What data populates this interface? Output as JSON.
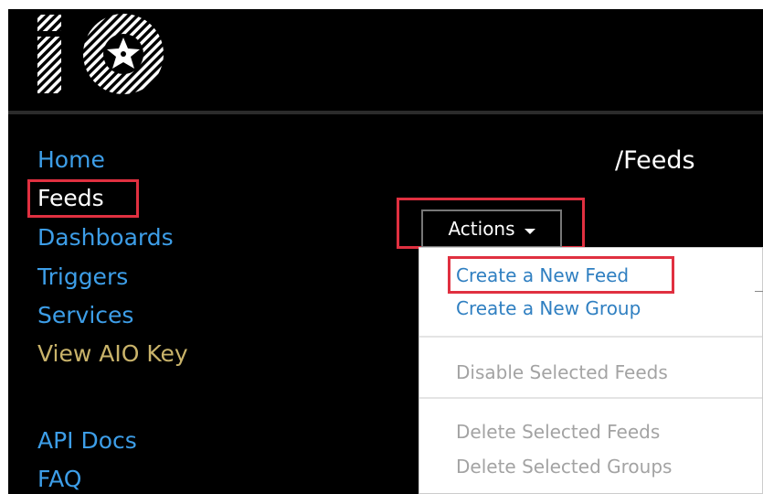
{
  "header": {
    "logo_icon": "adafruit-io-logo-icon"
  },
  "sidebar": {
    "items": [
      {
        "label": "Home",
        "color": "#3d9ee8"
      },
      {
        "label": "Feeds",
        "color": "#ffffff"
      },
      {
        "label": "Dashboards",
        "color": "#3d9ee8"
      },
      {
        "label": "Triggers",
        "color": "#3d9ee8"
      },
      {
        "label": "Services",
        "color": "#3d9ee8"
      },
      {
        "label": "View AIO Key",
        "color": "#c9b36a"
      },
      {
        "label": "API Docs",
        "color": "#3d9ee8"
      },
      {
        "label": "FAQ",
        "color": "#3d9ee8"
      }
    ]
  },
  "breadcrumb": {
    "separator": "/",
    "current": "Feeds"
  },
  "actions": {
    "label": "Actions",
    "caret_icon": "caret-down-icon",
    "menu": {
      "items": [
        {
          "label": "Create a New Feed",
          "enabled": true
        },
        {
          "label": "Create a New Group",
          "enabled": true
        },
        {
          "label": "Disable Selected Feeds",
          "enabled": false
        },
        {
          "label": "Delete Selected Feeds",
          "enabled": false
        },
        {
          "label": "Delete Selected Groups",
          "enabled": false
        }
      ]
    }
  },
  "colors": {
    "background": "#000000",
    "link": "#3d9ee8",
    "active": "#ffffff",
    "key": "#c9b36a",
    "highlight": "#e03040",
    "menu_link": "#2f7fc1",
    "menu_disabled": "#a3a3a3"
  }
}
